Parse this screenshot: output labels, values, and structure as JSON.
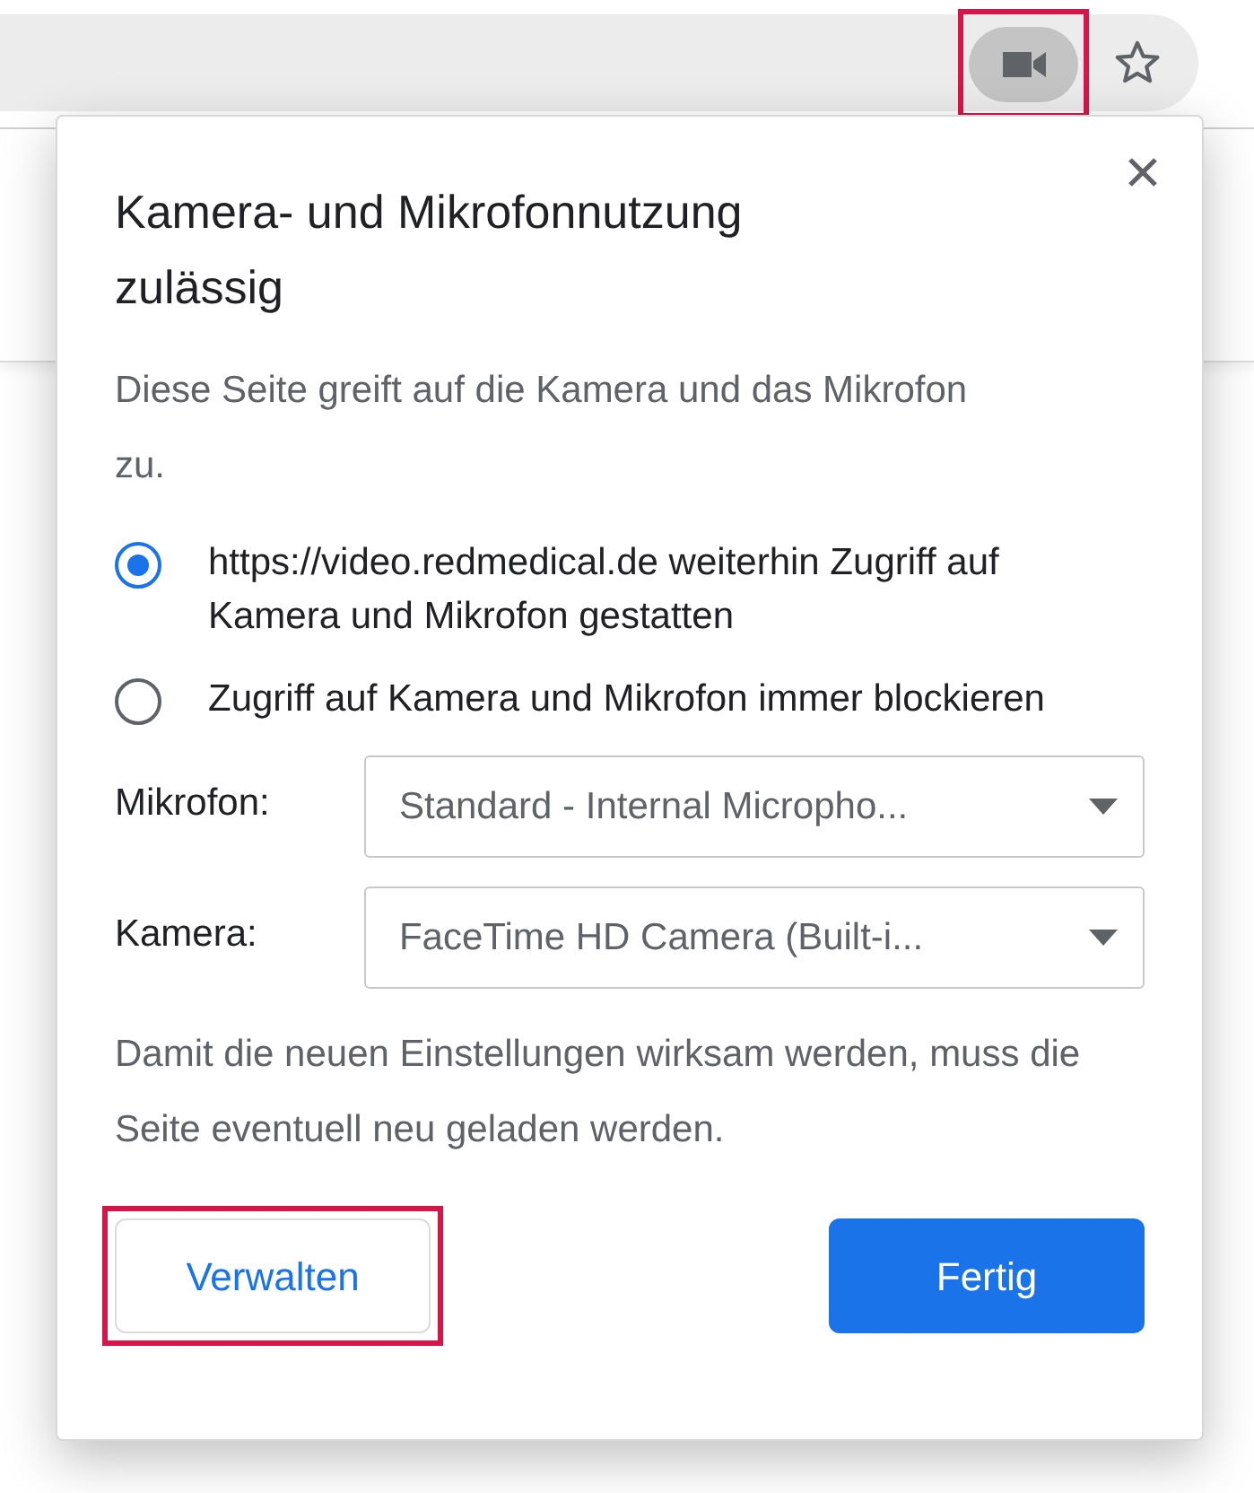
{
  "toolbar": {
    "camera_button": {
      "highlighted": true
    }
  },
  "dialog": {
    "title": "Kamera- und Mikrofonnutzung zulässig",
    "description": "Diese Seite greift auf die Kamera und das Mikrofon zu.",
    "options": [
      {
        "label": "https://video.redmedical.de weiterhin Zugriff auf Kamera und Mikrofon gestatten",
        "selected": true
      },
      {
        "label": "Zugriff auf Kamera und Mikrofon immer blockieren",
        "selected": false
      }
    ],
    "devices": [
      {
        "label": "Mikrofon:",
        "value": "Standard - Internal Micropho..."
      },
      {
        "label": "Kamera:",
        "value": "FaceTime HD Camera (Built-i..."
      }
    ],
    "note": "Damit die neuen Einstellungen wirksam werden, muss die Seite eventuell neu geladen werden.",
    "buttons": [
      {
        "label": "Verwalten",
        "kind": "secondary",
        "highlighted": true
      },
      {
        "label": "Fertig",
        "kind": "primary",
        "highlighted": false
      }
    ]
  }
}
